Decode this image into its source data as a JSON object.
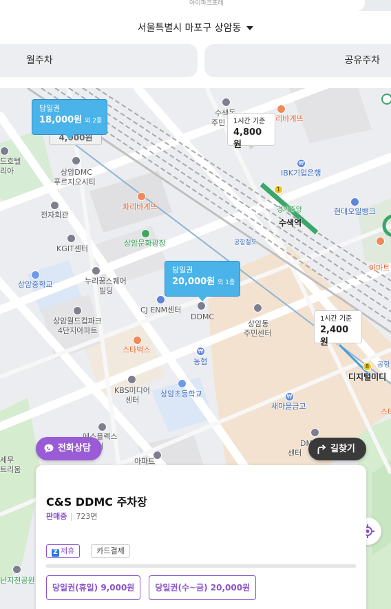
{
  "top_strip": {
    "label": "아이파크포레"
  },
  "header": {
    "region": "서울특별시 마포구 상암동",
    "tabs": [
      {
        "label": "월주차"
      },
      {
        "label": "공유주차"
      }
    ]
  },
  "map": {
    "pins": [
      {
        "kind": "당일권",
        "price": "18,000원",
        "extra": "외 2종"
      },
      {
        "kind": "당일권",
        "price": "20,000원",
        "extra": "외 1종"
      },
      {
        "basis": "1시간 기준",
        "price": "4,800원"
      },
      {
        "basis": "1시간 기준",
        "price": "2,400원"
      }
    ],
    "ghost_pin": {
      "price": "4,000원"
    },
    "labels": {
      "hotel": "드호텔",
      "hotel2": "리아",
      "sangam_dmc": "상암DMC",
      "prugio": "푸르지오시티",
      "jeonja": "전자회관",
      "paris1": "파리바게뜨",
      "sangam_plaza": "상암문화광장",
      "kgit": "KGIT센터",
      "nuri1": "누리꿈스퀘어",
      "nuri2": "빌딩",
      "sangam_ms": "상암중학교",
      "cjenm": "CJ ENM센터",
      "ddmc": "DDMC",
      "wc1": "상암월드컵파크",
      "wc2": "4단지아파트",
      "starbucks": "스타벅스",
      "nonghyup": "농협",
      "kbs1": "KBS미디어",
      "kbs2": "센터",
      "sangam_es": "상암초등학교",
      "sangam_center1": "상암동",
      "sangam_center2": "주민센터",
      "saemaeul": "새마을금고",
      "suseok_center1": "수색동",
      "suseok_center2": "주민",
      "paris2": "파리바게뜨",
      "ibk": "IBK기업은행",
      "hyundai": "현대오일뱅크",
      "gyeongui": "경의중앙",
      "suseok_stn": "수색역",
      "emart": "이마트",
      "digital": "디지털미디",
      "airport": "공항",
      "railroad": "공항철도",
      "star2": "스타",
      "espl1": "에스플렉스",
      "espl2": "센터",
      "dm1": "DM",
      "dm2": "센터",
      "sewoomu1": "세무",
      "sewoomu2": "트리움",
      "nanji": "난지천공원",
      "apart_top": "아파트",
      "line1": "1",
      "line8": "8"
    }
  },
  "actions": {
    "call_label": "전화상담",
    "route_label": "길찾기"
  },
  "lot": {
    "name": "C&S DDMC 주차장",
    "status": "판매중",
    "spaces": "723면",
    "tags": [
      "제휴",
      "카드결제"
    ],
    "tickets": [
      "당일권(휴일) 9,000원",
      "당일권(수~금) 20,000원"
    ]
  },
  "colors": {
    "accent": "#8a54c9",
    "pin_blue": "#49b3ea",
    "route_button": "#3a3a3a",
    "call_button": "#9a5bd6"
  }
}
